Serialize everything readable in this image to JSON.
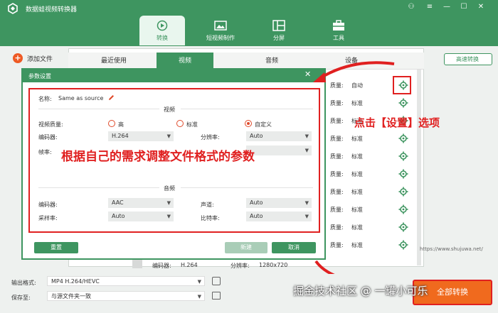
{
  "app": {
    "title": "数据蛙视频转换器",
    "window_controls": [
      "⚇",
      "≡",
      "—",
      "☐",
      "✕"
    ]
  },
  "nav": [
    {
      "label": "转换",
      "icon": "convert-icon"
    },
    {
      "label": "短视频制作",
      "icon": "image-icon"
    },
    {
      "label": "分屏",
      "icon": "split-screen-icon"
    },
    {
      "label": "工具",
      "icon": "toolbox-icon"
    }
  ],
  "toolbar": {
    "add_file": "添加文件",
    "fast_convert": "高速转换"
  },
  "outer_tabs": [
    "最近使用",
    "视频",
    "音频",
    "设备"
  ],
  "list_rows": [
    {
      "q": "质量:",
      "v": "自动"
    },
    {
      "q": "质量:",
      "v": "标准"
    },
    {
      "q": "质量:",
      "v": "标准"
    },
    {
      "q": "质量:",
      "v": "标准"
    },
    {
      "q": "质量:",
      "v": "标准"
    },
    {
      "q": "质量:",
      "v": "标准"
    },
    {
      "q": "质量:",
      "v": "标准"
    },
    {
      "q": "质量:",
      "v": "标准"
    },
    {
      "q": "质量:",
      "v": "标准"
    },
    {
      "q": "质量:",
      "v": "标准"
    }
  ],
  "dialog": {
    "title": "参数设置",
    "name_label": "名称:",
    "name_value": "Same as source",
    "video_section": "视频",
    "video_quality_label": "视频质量:",
    "quality_options": [
      "高",
      "标准",
      "自定义"
    ],
    "selected_quality": "自定义",
    "encoder_label": "编码器:",
    "encoder_value": "H.264",
    "resolution_label": "分辨率:",
    "resolution_value": "Auto",
    "framerate_label": "帧率:",
    "audio_section": "音频",
    "audio_encoder_label": "编码器:",
    "audio_encoder_value": "AAC",
    "channel_label": "声道:",
    "channel_value": "Auto",
    "samplerate_label": "采样率:",
    "samplerate_value": "Auto",
    "bitrate_label": "比特率:",
    "bitrate_value": "Auto",
    "reset_button": "重置",
    "create_button": "新建",
    "cancel_button": "取消"
  },
  "annotations": {
    "callout_main": "根据自己的需求调整文件格式的参数",
    "callout_setting": "点击【设置】选项"
  },
  "file_row": {
    "encoder": "编码器:",
    "encoder_value": "H.264",
    "resolution": "分辨率:",
    "resolution_value": "1280x720"
  },
  "bottom": {
    "output_label": "输出格式:",
    "output_value": "MP4 H.264/HEVC",
    "save_label": "保存至:",
    "save_value": "与源文件夹一致",
    "convert_all": "全部转换"
  },
  "site": "https://www.shujuwa.net/",
  "watermark": "掘金技术社区 @ 一罐小可乐",
  "colors": {
    "brand": "#3e9560",
    "accent_red": "#e02020",
    "orange": "#f06a1e"
  }
}
